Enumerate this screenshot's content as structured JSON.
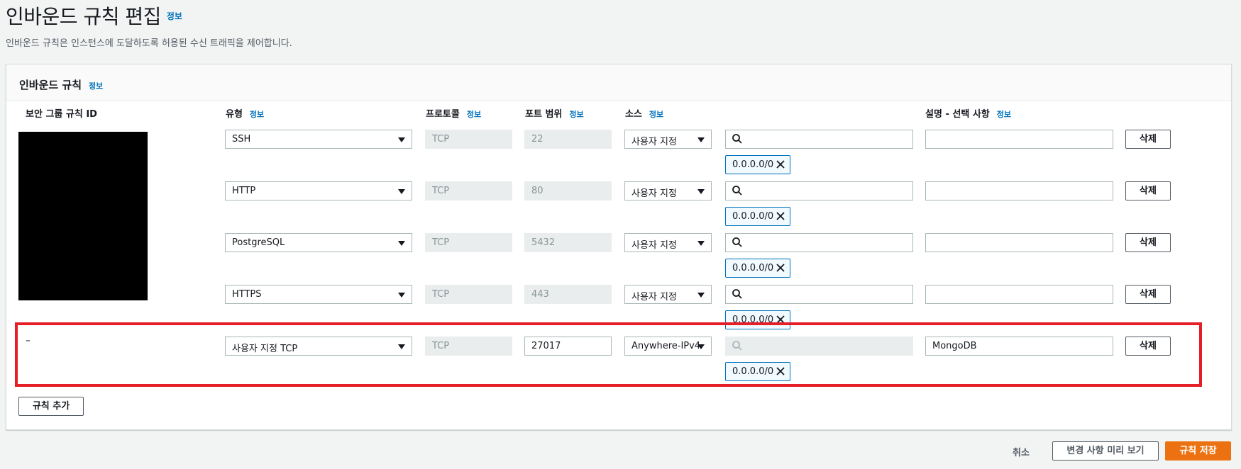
{
  "page": {
    "title": "인바운드 규칙 편집",
    "title_info": "정보",
    "description": "인바운드 규칙은 인스턴스에 도달하도록 허용된 수신 트래픽을 제어합니다."
  },
  "panel": {
    "title": "인바운드 규칙",
    "title_info": "정보",
    "columns": {
      "rule_id": "보안 그룹 규칙 ID",
      "type": "유형",
      "protocol": "프로토콜",
      "port_range": "포트 범위",
      "source": "소스",
      "description": "설명 - 선택 사항",
      "info": "정보"
    },
    "rules": [
      {
        "type": "SSH",
        "protocol": "TCP",
        "port": "22",
        "source_type": "사용자 지정",
        "cidr": "0.0.0.0/0",
        "description": "",
        "delete": "삭제"
      },
      {
        "type": "HTTP",
        "protocol": "TCP",
        "port": "80",
        "source_type": "사용자 지정",
        "cidr": "0.0.0.0/0",
        "description": "",
        "delete": "삭제"
      },
      {
        "type": "PostgreSQL",
        "protocol": "TCP",
        "port": "5432",
        "source_type": "사용자 지정",
        "cidr": "0.0.0.0/0",
        "description": "",
        "delete": "삭제"
      },
      {
        "type": "HTTPS",
        "protocol": "TCP",
        "port": "443",
        "source_type": "사용자 지정",
        "cidr": "0.0.0.0/0",
        "description": "",
        "delete": "삭제"
      },
      {
        "rule_id": "–",
        "type": "사용자 지정 TCP",
        "protocol": "TCP",
        "port": "27017",
        "source_type": "Anywhere-IPv4",
        "cidr": "0.0.0.0/0",
        "description": "MongoDB",
        "delete": "삭제"
      }
    ],
    "add_rule": "규칙 추가"
  },
  "footer": {
    "cancel": "취소",
    "preview": "변경 사항 미리 보기",
    "save": "규칙 저장"
  },
  "colors": {
    "accent": "#0073bb",
    "primary_button": "#ec7211",
    "highlight": "#e61e28"
  }
}
